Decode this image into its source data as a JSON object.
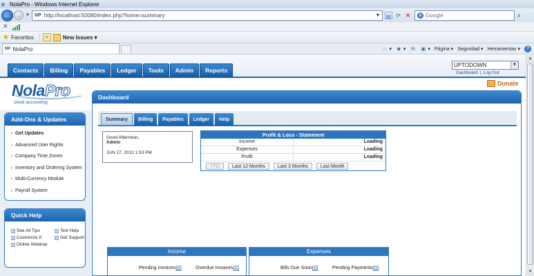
{
  "browser": {
    "window_title": "NolaPro - Windows Internet Explorer",
    "address_url": "http://localhost:50080/index.php?home=summary",
    "address_prefix": "NP",
    "search_placeholder": "Google",
    "favorites_label": "Favoritos",
    "new_issues_label": "New Issues ▾",
    "tab_title": "NolaPro",
    "tab_prefix": "NP",
    "commands": {
      "page": "Página ▾",
      "security": "Seguridad ▾",
      "tools": "Herramientas ▾"
    }
  },
  "app": {
    "main_nav": [
      "Contacts",
      "Billing",
      "Payables",
      "Ledger",
      "Tools",
      "Admin",
      "Reports"
    ],
    "company_select": "UPTODOWN",
    "top_links": {
      "dashboard": "Dashboard",
      "sep": "|",
      "logout": "Log Out"
    },
    "donate": "Donate",
    "logo": {
      "nola": "Nola",
      "pro": "Pro",
      "sub": "cloud accounting"
    }
  },
  "sidebar": {
    "addons_title": "Add-Ons & Updates",
    "addons_items": [
      "Get Updates",
      "Advanced User Rights",
      "Company Time Zones",
      "Inventory and Ordering System",
      "Multi-Currency Module",
      "Payroll System"
    ],
    "quick_help_title": "Quick Help",
    "quick_help_items": [
      "See All Tips",
      "Text Help",
      "Customize It",
      "Get Support",
      "Online Webinar"
    ]
  },
  "dashboard": {
    "title": "Dashboard",
    "subtabs": [
      "Summary",
      "Billing",
      "Payables",
      "Ledger",
      "Help"
    ],
    "active_subtab": "Summary",
    "greeting": "Good Afternoon,",
    "user": "Admin",
    "datetime": "JUN 27, 2013 1:53 PM",
    "pl": {
      "title": "Profit & Loss - Statement",
      "rows": [
        {
          "label": "Income",
          "value": "Loading"
        },
        {
          "label": "Expenses",
          "value": "Loading"
        },
        {
          "label": "Profit",
          "value": "Loading"
        }
      ],
      "buttons": [
        "YTD",
        "Last 12 Months",
        "Last 3 Months",
        "Last Month"
      ]
    },
    "income": {
      "title": "Income",
      "items": [
        {
          "label": "Pending Invoices",
          "count": "(0)"
        },
        {
          "label": "Overdue Invoices",
          "count": "(0)"
        }
      ]
    },
    "expenses": {
      "title": "Expenses",
      "items": [
        {
          "label": "Bills Due Soon",
          "count": "(0)"
        },
        {
          "label": "Pending Payments",
          "count": "(0)"
        }
      ]
    }
  }
}
